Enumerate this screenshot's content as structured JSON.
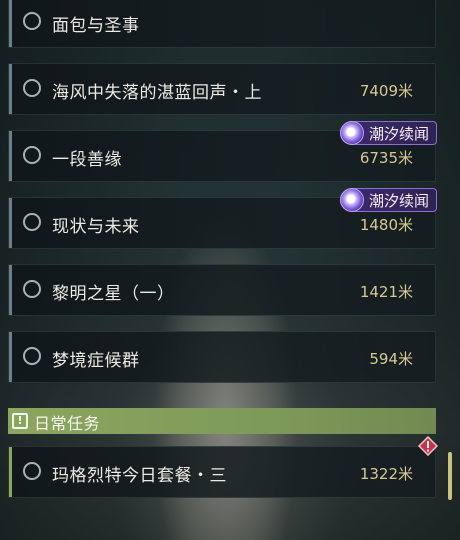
{
  "quests": [
    {
      "title": "面包与圣事",
      "distance": ""
    },
    {
      "title": "海风中失落的湛蓝回声・上",
      "distance": "7409米"
    },
    {
      "title": "一段善缘",
      "distance": "6735米",
      "tag": "潮汐续闻"
    },
    {
      "title": "现状与未来",
      "distance": "1480米",
      "tag": "潮汐续闻"
    },
    {
      "title": "黎明之星（一）",
      "distance": "1421米"
    },
    {
      "title": "梦境症候群",
      "distance": "594米"
    }
  ],
  "section": {
    "label": "日常任务",
    "icon": "info-square-icon",
    "color": "#8aa65f"
  },
  "daily_quests": [
    {
      "title": "玛格烈特今日套餐・三",
      "distance": "1322米",
      "icon": "warning-diamond-icon"
    }
  ],
  "colors": {
    "distance": "#d8c993",
    "tag_accent": "#8e6dd8",
    "warning": "#c9334a",
    "scroll_thumb": "#c9c27a"
  }
}
